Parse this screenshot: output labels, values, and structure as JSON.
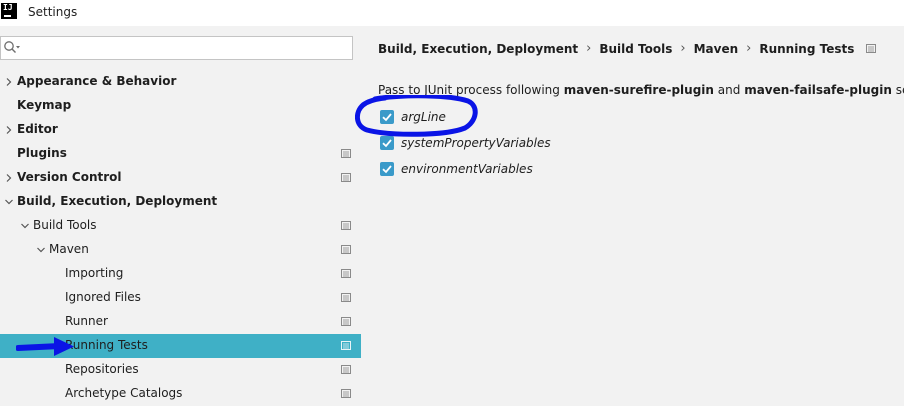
{
  "window": {
    "title": "Settings",
    "logo_text": "IJ"
  },
  "search": {
    "value": "",
    "placeholder": ""
  },
  "tree": [
    {
      "label": "Appearance & Behavior",
      "level": 0,
      "expanded": false,
      "has_children": true,
      "bold": true,
      "project_icon": false,
      "selected": false
    },
    {
      "label": "Keymap",
      "level": 0,
      "expanded": false,
      "has_children": false,
      "bold": true,
      "project_icon": false,
      "selected": false
    },
    {
      "label": "Editor",
      "level": 0,
      "expanded": false,
      "has_children": true,
      "bold": true,
      "project_icon": false,
      "selected": false
    },
    {
      "label": "Plugins",
      "level": 0,
      "expanded": false,
      "has_children": false,
      "bold": true,
      "project_icon": true,
      "selected": false
    },
    {
      "label": "Version Control",
      "level": 0,
      "expanded": false,
      "has_children": true,
      "bold": true,
      "project_icon": true,
      "selected": false
    },
    {
      "label": "Build, Execution, Deployment",
      "level": 0,
      "expanded": true,
      "has_children": true,
      "bold": true,
      "project_icon": false,
      "selected": false
    },
    {
      "label": "Build Tools",
      "level": 1,
      "expanded": true,
      "has_children": true,
      "bold": false,
      "project_icon": true,
      "selected": false
    },
    {
      "label": "Maven",
      "level": 2,
      "expanded": true,
      "has_children": true,
      "bold": false,
      "project_icon": true,
      "selected": false
    },
    {
      "label": "Importing",
      "level": 3,
      "expanded": false,
      "has_children": false,
      "bold": false,
      "project_icon": true,
      "selected": false
    },
    {
      "label": "Ignored Files",
      "level": 3,
      "expanded": false,
      "has_children": false,
      "bold": false,
      "project_icon": true,
      "selected": false
    },
    {
      "label": "Runner",
      "level": 3,
      "expanded": false,
      "has_children": false,
      "bold": false,
      "project_icon": true,
      "selected": false
    },
    {
      "label": "Running Tests",
      "level": 3,
      "expanded": false,
      "has_children": false,
      "bold": false,
      "project_icon": true,
      "selected": true
    },
    {
      "label": "Repositories",
      "level": 3,
      "expanded": false,
      "has_children": false,
      "bold": false,
      "project_icon": true,
      "selected": false
    },
    {
      "label": "Archetype Catalogs",
      "level": 3,
      "expanded": false,
      "has_children": false,
      "bold": false,
      "project_icon": true,
      "selected": false
    }
  ],
  "breadcrumb": [
    "Build, Execution, Deployment",
    "Build Tools",
    "Maven",
    "Running Tests"
  ],
  "content": {
    "desc_prefix": "Pass to JUnit process following ",
    "desc_plugin1": "maven-surefire-plugin",
    "desc_and": " and ",
    "desc_plugin2": "maven-failsafe-plugin",
    "desc_suffix": " settings:",
    "checkboxes": [
      {
        "label": "argLine",
        "checked": true
      },
      {
        "label": "systemPropertyVariables",
        "checked": true
      },
      {
        "label": "environmentVariables",
        "checked": true
      }
    ]
  },
  "colors": {
    "selection": "#3fb0c6",
    "checkbox": "#3a9ac9",
    "annotation": "#0a14e6"
  }
}
